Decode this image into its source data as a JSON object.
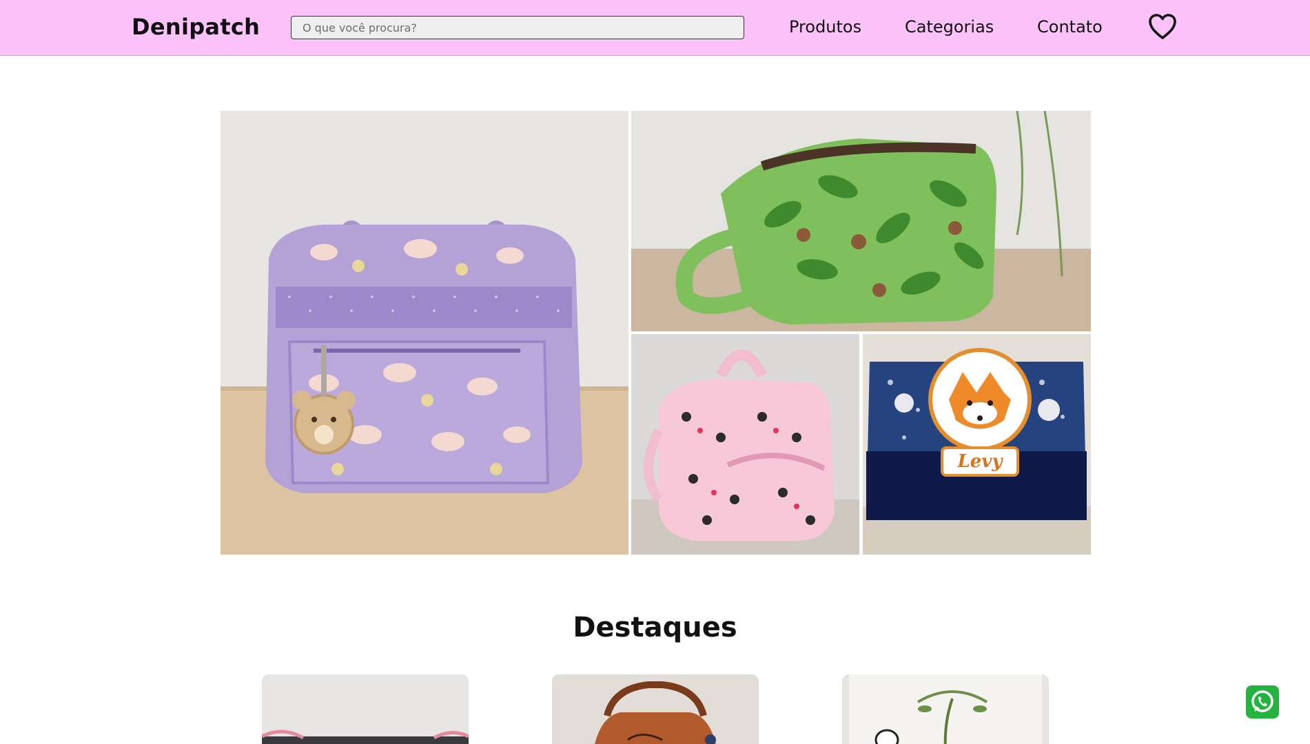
{
  "header": {
    "brand": "Denipatch",
    "search_placeholder": "O que você procura?",
    "nav": [
      {
        "label": "Produtos"
      },
      {
        "label": "Categorias"
      },
      {
        "label": "Contato"
      }
    ],
    "favorites_icon": "heart-icon",
    "background_color": "#fbc3fa"
  },
  "hero": {
    "images": [
      {
        "name": "lilac-diaper-bag",
        "embroidered_text": ""
      },
      {
        "name": "green-monkey-toiletry-bag",
        "embroidered_text": ""
      },
      {
        "name": "pink-minnie-bag",
        "embroidered_text": ""
      },
      {
        "name": "navy-fox-pouch",
        "embroidered_text": "Levy"
      }
    ]
  },
  "featured": {
    "title": "Destaques",
    "cards": [
      {
        "name": "featured-card-1"
      },
      {
        "name": "featured-card-2"
      },
      {
        "name": "featured-card-3"
      }
    ]
  },
  "whatsapp": {
    "icon": "whatsapp-icon",
    "color": "#25b340"
  }
}
